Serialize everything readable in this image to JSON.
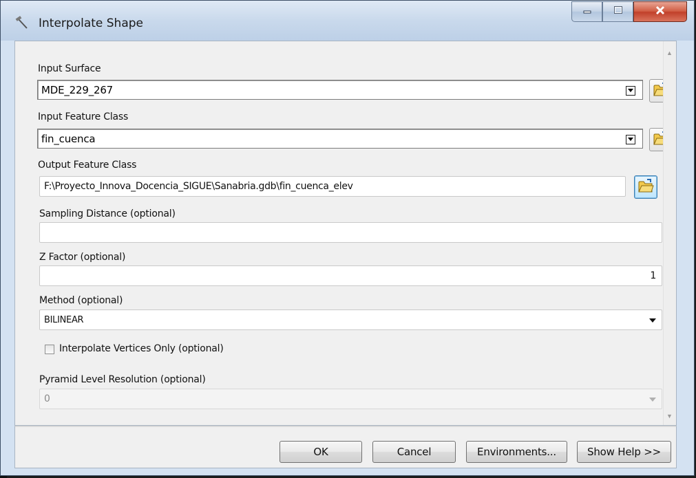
{
  "window": {
    "title": "Interpolate Shape",
    "icon": "tool-hammer-icon"
  },
  "form": {
    "input_surface": {
      "label": "Input Surface",
      "value": "MDE_229_267"
    },
    "input_feature_class": {
      "label": "Input Feature Class",
      "value": "fin_cuenca"
    },
    "output_feature_class": {
      "label": "Output Feature Class",
      "value": "F:\\Proyecto_Innova_Docencia_SIGUE\\Sanabria.gdb\\fin_cuenca_elev"
    },
    "sampling_distance": {
      "label": "Sampling Distance (optional)",
      "value": ""
    },
    "z_factor": {
      "label": "Z Factor (optional)",
      "value": "1"
    },
    "method": {
      "label": "Method (optional)",
      "value": "BILINEAR"
    },
    "interpolate_vertices": {
      "label": "Interpolate Vertices Only (optional)",
      "checked": false
    },
    "pyramid_level": {
      "label": "Pyramid Level Resolution (optional)",
      "value": "0"
    }
  },
  "buttons": {
    "ok": "OK",
    "cancel": "Cancel",
    "environments": "Environments...",
    "show_help": "Show Help >>"
  },
  "colors": {
    "title_bar": "#c9d9ec",
    "client_bg": "#f0f0f0",
    "close_button": "#c1402a"
  }
}
